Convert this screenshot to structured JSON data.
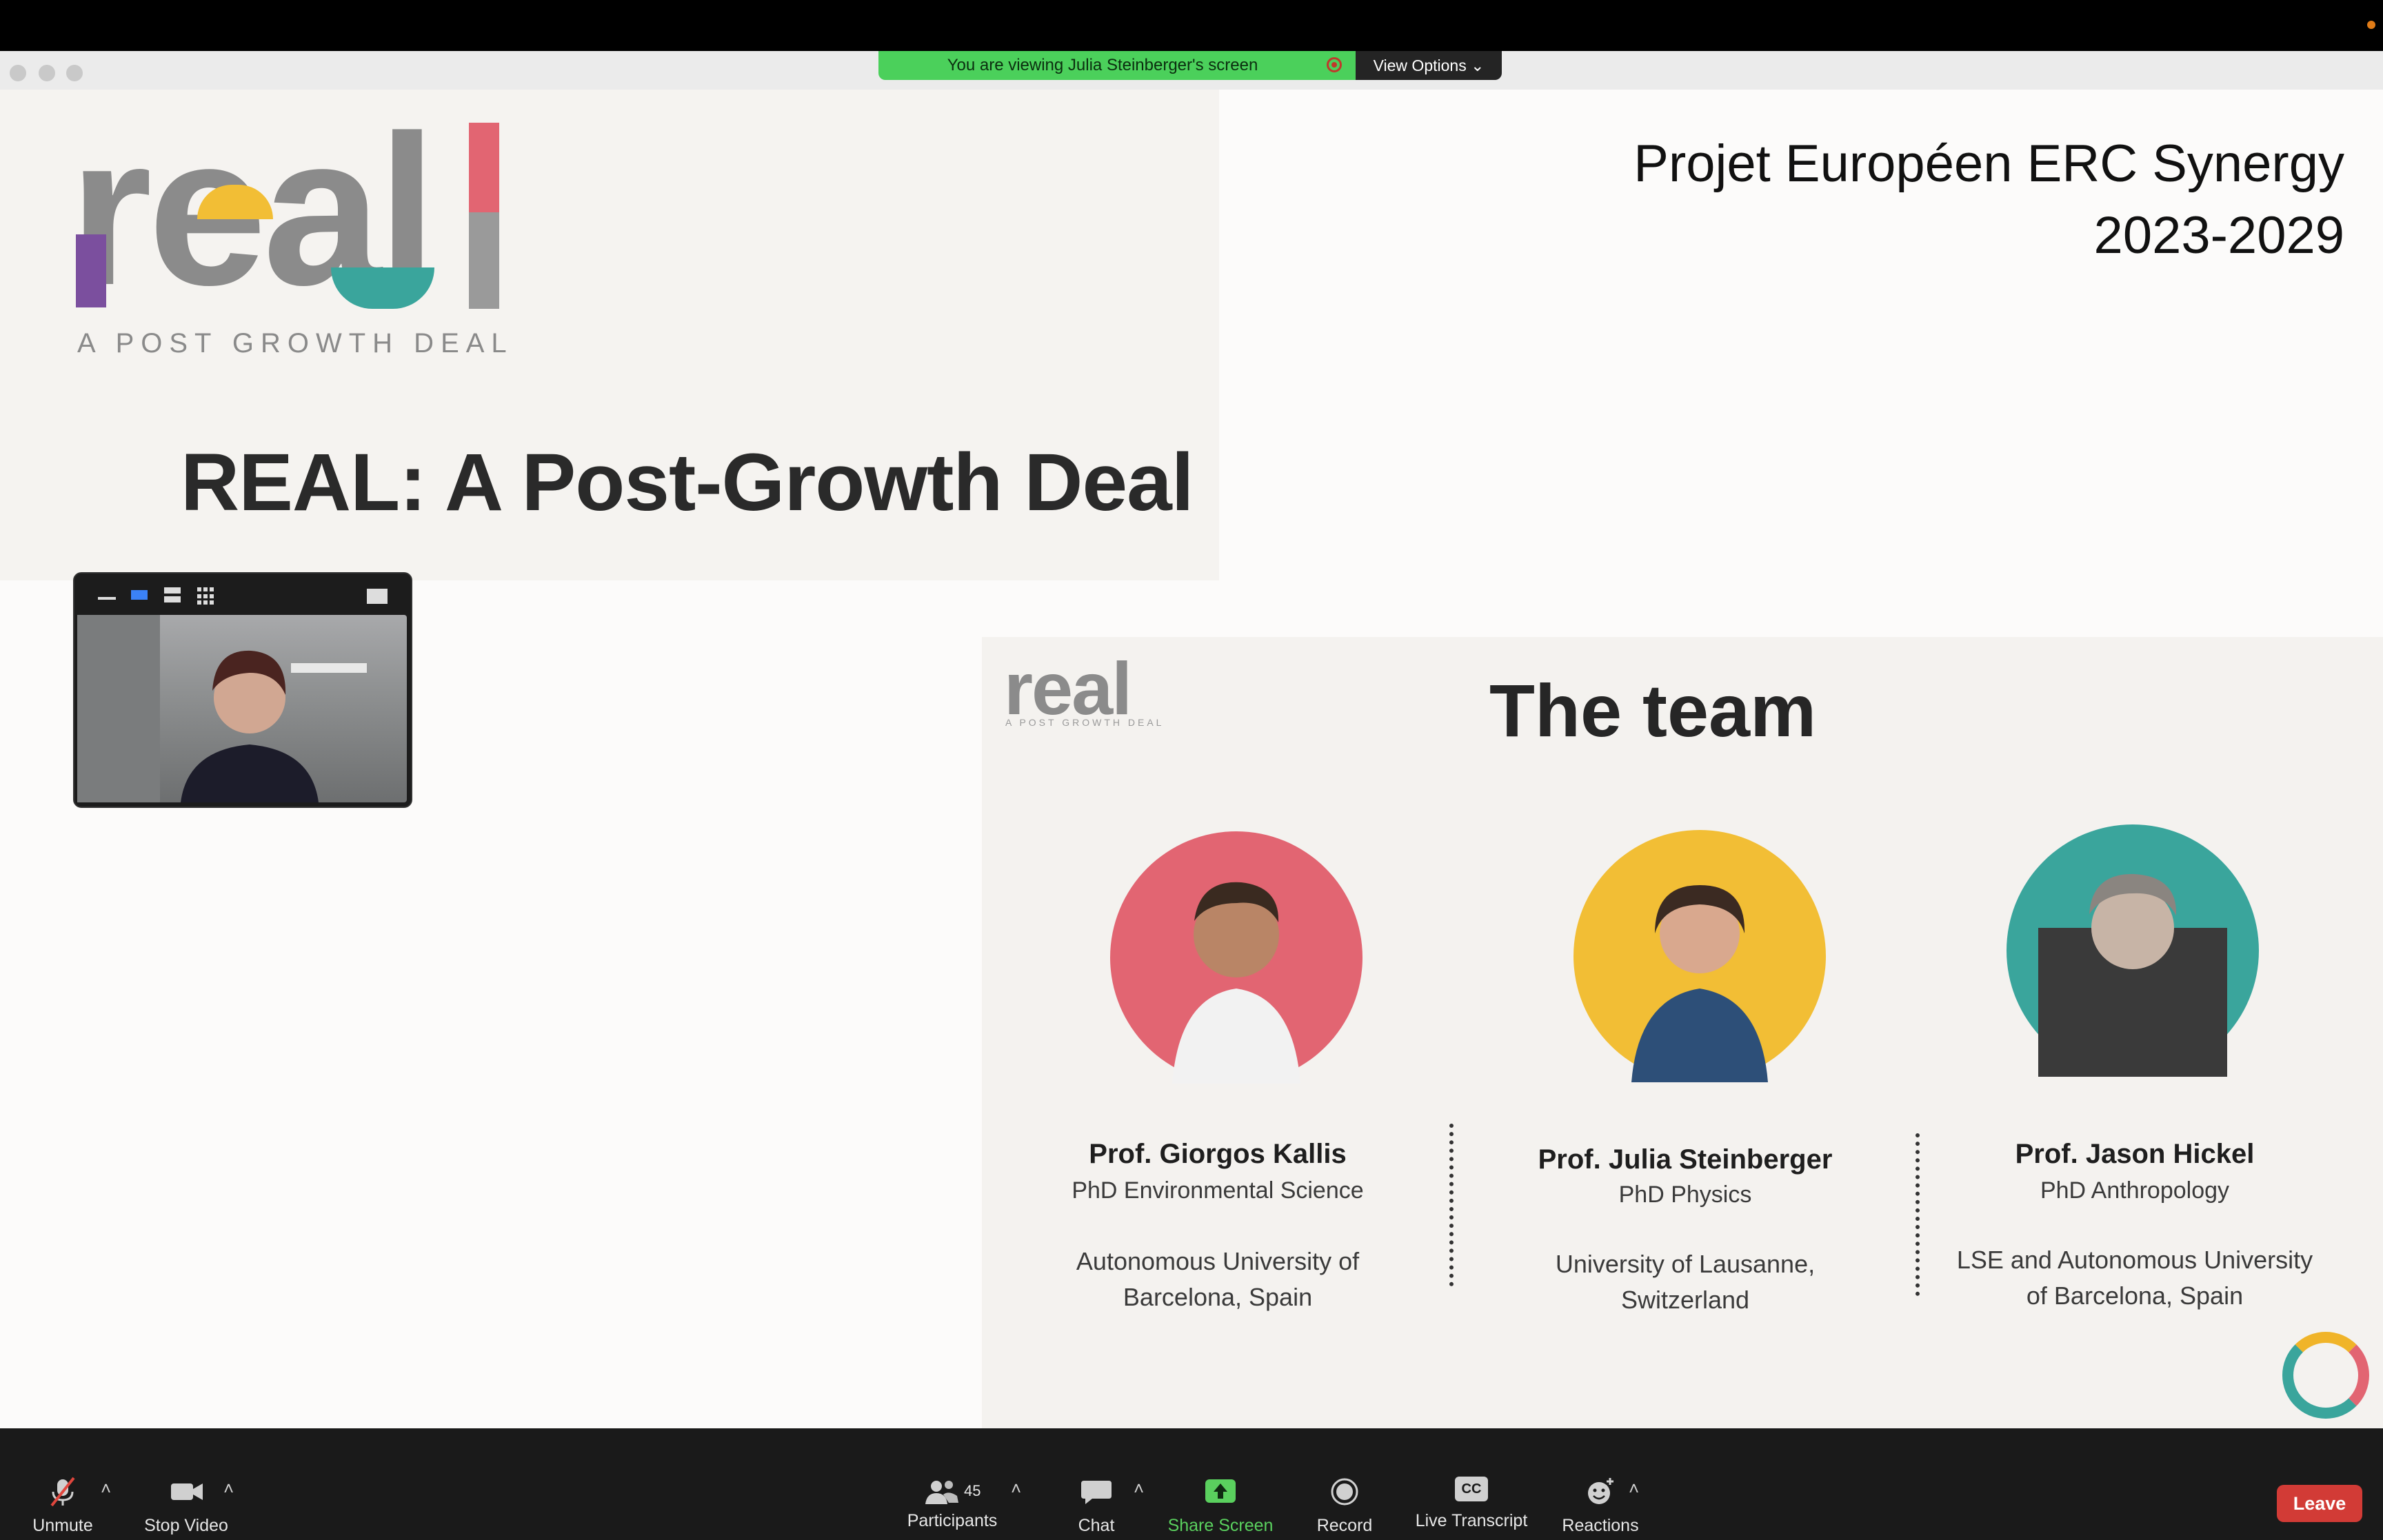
{
  "share_banner": {
    "text": "You are viewing Julia Steinberger's screen",
    "view_options": "View Options"
  },
  "slide1": {
    "logo_text": "real",
    "tagline": "A POST GROWTH DEAL",
    "title": "REAL: A Post-Growth Deal",
    "erc_line1": "Projet Européen ERC Synergy",
    "erc_line2": "2023-2029"
  },
  "slide2": {
    "logo_text": "real",
    "logo_tagline": "A POST GROWTH DEAL",
    "title": "The team",
    "people": [
      {
        "name": "Prof. Giorgos Kallis",
        "degree": "PhD Environmental Science",
        "uni_line1": "Autonomous University of",
        "uni_line2": "Barcelona, Spain",
        "color": "#e26572"
      },
      {
        "name": "Prof. Julia Steinberger",
        "degree": "PhD Physics",
        "uni_line1": "University of Lausanne,",
        "uni_line2": "Switzerland",
        "color": "#f2be35"
      },
      {
        "name": "Prof. Jason Hickel",
        "degree": "PhD Anthropology",
        "uni_line1": "LSE and Autonomous University",
        "uni_line2": "of Barcelona, Spain",
        "color": "#3aa59c"
      }
    ]
  },
  "toolbar": {
    "unmute": "Unmute",
    "stop_video": "Stop Video",
    "participants": "Participants",
    "participants_count": "45",
    "chat": "Chat",
    "share_screen": "Share Screen",
    "record": "Record",
    "live_transcript": "Live Transcript",
    "live_transcript_icon_text": "CC",
    "reactions": "Reactions",
    "leave": "Leave"
  },
  "colors": {
    "banner_green": "#4bd05b",
    "leave_red": "#d23b36",
    "share_screen_green": "#5ad05e",
    "logo_pink": "#e26572",
    "logo_yellow": "#f2be35",
    "logo_teal": "#3aa59c",
    "logo_purple": "#7b4f9e"
  }
}
